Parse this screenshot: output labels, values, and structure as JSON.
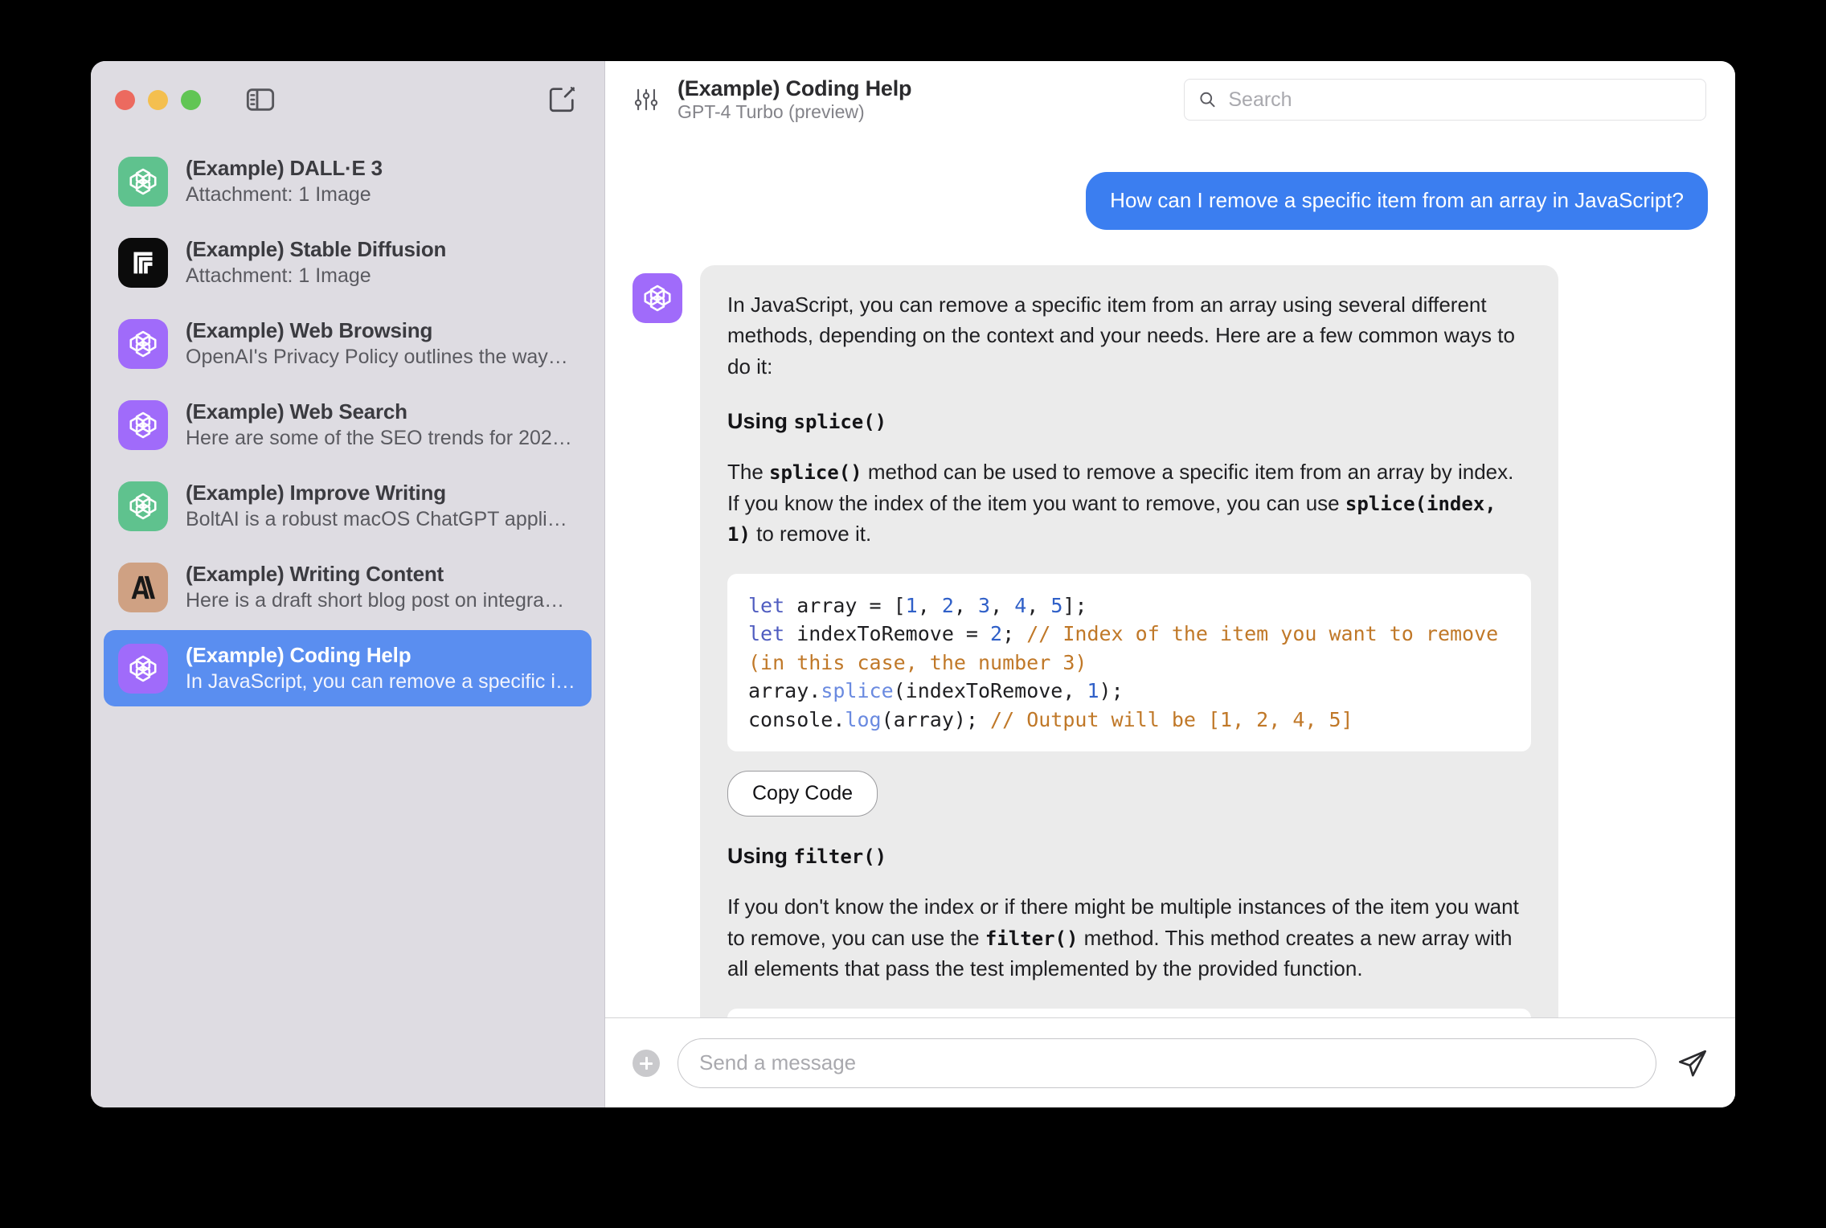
{
  "window": {
    "traffic_lights": [
      "close",
      "minimize",
      "zoom"
    ],
    "sidebar_toggle_label": "Toggle Sidebar",
    "compose_label": "New Chat"
  },
  "sidebar": {
    "items": [
      {
        "title": "(Example) DALL·E 3",
        "subtitle": "Attachment: 1 Image",
        "icon": "openai-icon",
        "icon_bg": "#5fc28e",
        "selected": false
      },
      {
        "title": "(Example) Stable Diffusion",
        "subtitle": "Attachment: 1 Image",
        "icon": "stability-icon",
        "icon_bg": "#0b0b0b",
        "selected": false
      },
      {
        "title": "(Example) Web Browsing",
        "subtitle": "OpenAI's Privacy Policy outlines the way…",
        "icon": "openai-icon",
        "icon_bg": "#a06bfa",
        "selected": false
      },
      {
        "title": "(Example) Web Search",
        "subtitle": "Here are some of the SEO trends for 202…",
        "icon": "openai-icon",
        "icon_bg": "#a06bfa",
        "selected": false
      },
      {
        "title": "(Example) Improve Writing",
        "subtitle": "BoltAI is a robust macOS ChatGPT applic…",
        "icon": "openai-icon",
        "icon_bg": "#5fc28e",
        "selected": false
      },
      {
        "title": "(Example) Writing Content",
        "subtitle": "Here is a draft short blog post on integra…",
        "icon": "anthropic-icon",
        "icon_bg": "#cfa183",
        "selected": false
      },
      {
        "title": "(Example) Coding Help",
        "subtitle": "In JavaScript, you can remove a specific i…",
        "icon": "openai-icon",
        "icon_bg": "#a06bfa",
        "selected": true
      }
    ]
  },
  "header": {
    "settings_icon": "sliders-icon",
    "title": "(Example) Coding Help",
    "model": "GPT-4 Turbo (preview)",
    "search": {
      "placeholder": "Search",
      "value": "",
      "icon": "search-icon"
    }
  },
  "conversation": {
    "user_message": "How can I remove a specific item from an array in JavaScript?",
    "assistant_avatar": {
      "icon": "openai-icon",
      "icon_bg": "#a06bfa"
    },
    "assistant": {
      "intro": "In JavaScript, you can remove a specific item from an array using several different methods, depending on the context and your needs. Here are a few common ways to do it:",
      "section1": {
        "heading_prefix": "Using ",
        "heading_code": "splice()",
        "para_a": "The ",
        "para_code_1": "splice()",
        "para_b": " method can be used to remove a specific item from an array by index. If you know the index of the item you want to remove, you can use ",
        "para_code_2": "splice(index, 1)",
        "para_c": " to remove it.",
        "code": {
          "line1_kw": "let",
          "line1_a": " array = [",
          "line1_n1": "1",
          "line1_b": ", ",
          "line1_n2": "2",
          "line1_c": ", ",
          "line1_n3": "3",
          "line1_d": ", ",
          "line1_n4": "4",
          "line1_e": ", ",
          "line1_n5": "5",
          "line1_f": "];",
          "line2_kw": "let",
          "line2_a": " indexToRemove = ",
          "line2_n": "2",
          "line2_b": "; ",
          "line2_cmt": "// Index of the item you want to remove (in this case, the number 3)",
          "line3_a": "array.",
          "line3_fn": "splice",
          "line3_b": "(indexToRemove, ",
          "line3_n": "1",
          "line3_c": ");",
          "line4_a": "console.",
          "line4_fn": "log",
          "line4_b": "(array); ",
          "line4_cmt": "// Output will be [1, 2, 4, 5]"
        },
        "copy_label": "Copy Code"
      },
      "section2": {
        "heading_prefix": "Using ",
        "heading_code": "filter()",
        "para_a": "If you don't know the index or if there might be multiple instances of the item you want to remove, you can use the ",
        "para_code": "filter()",
        "para_b": " method. This method creates a new array with all elements that pass the test implemented by the provided function."
      }
    }
  },
  "composer": {
    "add_label": "+",
    "placeholder": "Send a message",
    "value": "",
    "send_icon": "send-icon"
  },
  "colors": {
    "accent_blue": "#3b7ef0",
    "selected_row": "#5a8ef0",
    "sidebar_bg": "#dedce2",
    "assistant_bubble": "#ebebeb",
    "code_bg": "#ffffff",
    "keyword": "#4f5cc0",
    "number": "#3060c8",
    "function": "#6a8ae0",
    "comment": "#c07828"
  }
}
